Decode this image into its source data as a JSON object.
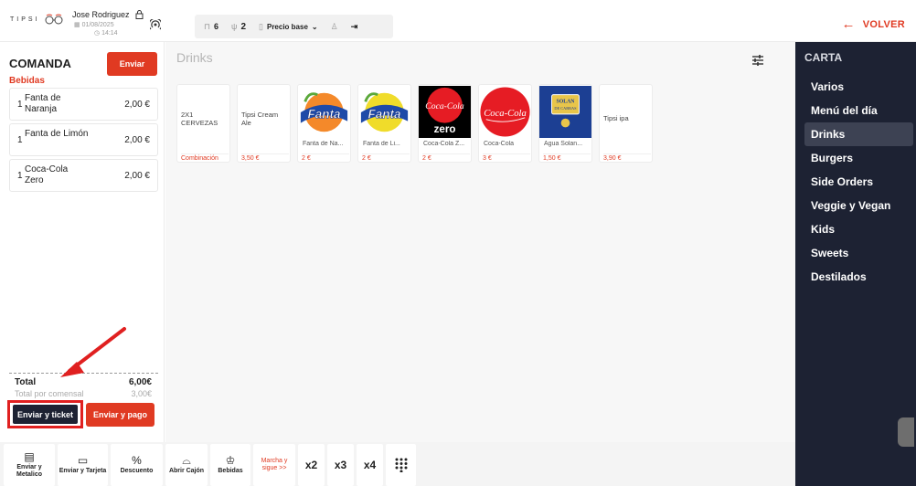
{
  "header": {
    "logo_text": "TIPSI",
    "user_name": "Jose Rodriguez",
    "date": "01/08/2025",
    "time": "14:14",
    "table_count": "6",
    "guests": "2",
    "price_mode": "Precio base",
    "back_label": "VOLVER"
  },
  "comanda": {
    "title": "COMANDA",
    "send_label": "Enviar",
    "category": "Bebidas",
    "items": [
      {
        "qty": "1",
        "name": "Fanta de Naranja",
        "price": "2,00 €"
      },
      {
        "qty": "1",
        "name": "Fanta de Limón",
        "price": "2,00 €"
      },
      {
        "qty": "1",
        "name": "Coca-Cola Zero",
        "price": "2,00 €"
      }
    ],
    "total_label": "Total",
    "total_value": "6,00€",
    "per_guest_label": "Total por comensal",
    "per_guest_value": "3,00€",
    "send_ticket_label": "Enviar y ticket",
    "send_pay_label": "Enviar y pago"
  },
  "main": {
    "section_title": "Drinks",
    "products": [
      {
        "name": "2X1 CERVEZAS",
        "label": "Combinación",
        "price": "",
        "image": "none"
      },
      {
        "name": "Tipsi Cream Ale",
        "label": "",
        "price": "3,50 €",
        "image": "none"
      },
      {
        "name": "",
        "label": "Fanta de Na...",
        "price": "2 €",
        "image": "fanta-orange"
      },
      {
        "name": "",
        "label": "Fanta de Li...",
        "price": "2 €",
        "image": "fanta-lemon"
      },
      {
        "name": "",
        "label": "Coca-Cola Z...",
        "price": "2 €",
        "image": "coca-cola-zero"
      },
      {
        "name": "",
        "label": "Coca-Cola",
        "price": "3 €",
        "image": "coca-cola"
      },
      {
        "name": "",
        "label": "Agua Solan...",
        "price": "1,50 €",
        "image": "solan-de-cabras"
      },
      {
        "name": "Tipsi ipa",
        "label": "",
        "price": "3,90 €",
        "image": "none"
      }
    ]
  },
  "menu": {
    "title": "CARTA",
    "items": [
      "Varios",
      "Menú del día",
      "Drinks",
      "Burgers",
      "Side Orders",
      "Veggie y Vegan",
      "Kids",
      "Sweets",
      "Destilados"
    ],
    "active_index": 2
  },
  "toolbar": {
    "enviar_metalico": "Enviar y Metalico",
    "enviar_tarjeta": "Enviar y Tarjeta",
    "descuento": "Descuento",
    "abrir_cajon": "Abrir Cajón",
    "bebidas": "Bebidas",
    "marcha": "Marcha y sigue >>",
    "x2": "x2",
    "x3": "x3",
    "x4": "x4"
  },
  "colors": {
    "accent": "#e03a22",
    "menu_bg": "#1d2233",
    "menu_active": "#3d4253"
  }
}
